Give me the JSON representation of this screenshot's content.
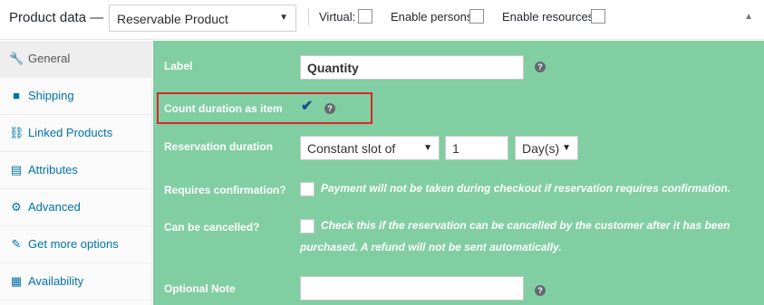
{
  "header": {
    "title": "Product data —",
    "product_type": "Reservable Product",
    "virtual_label": "Virtual:",
    "virtual_checked": false,
    "enable_persons_label": "Enable persons:",
    "enable_persons_checked": false,
    "enable_resources_label": "Enable resources:",
    "enable_resources_checked": false
  },
  "sidebar": {
    "items": [
      {
        "label": "General",
        "icon": "wrench-icon",
        "active": true
      },
      {
        "label": "Shipping",
        "icon": "truck-icon",
        "active": false
      },
      {
        "label": "Linked Products",
        "icon": "link-icon",
        "active": false
      },
      {
        "label": "Attributes",
        "icon": "list-icon",
        "active": false
      },
      {
        "label": "Advanced",
        "icon": "gear-icon",
        "active": false
      },
      {
        "label": "Get more options",
        "icon": "plugin-icon",
        "active": false
      },
      {
        "label": "Availability",
        "icon": "calendar-icon",
        "active": false
      }
    ]
  },
  "form": {
    "label_field": {
      "label": "Label",
      "value": "Quantity"
    },
    "count_duration": {
      "label": "Count duration as item",
      "checked": true
    },
    "reservation_duration": {
      "label": "Reservation duration",
      "type": "Constant slot of",
      "amount": "1",
      "unit": "Day(s)"
    },
    "requires_confirmation": {
      "label": "Requires confirmation?",
      "checked": false,
      "description": "Payment will not be taken during checkout if reservation requires confirmation."
    },
    "can_be_cancelled": {
      "label": "Can be cancelled?",
      "checked": false,
      "description_line1": "Check this if the reservation can be cancelled by the customer after it has been",
      "description_line2": "purchased. A refund will not be sent automatically."
    },
    "optional_note": {
      "label": "Optional Note",
      "value": ""
    }
  },
  "colors": {
    "panel_bg": "#81cea2",
    "highlight": "#d9262a",
    "link": "#0073aa"
  }
}
